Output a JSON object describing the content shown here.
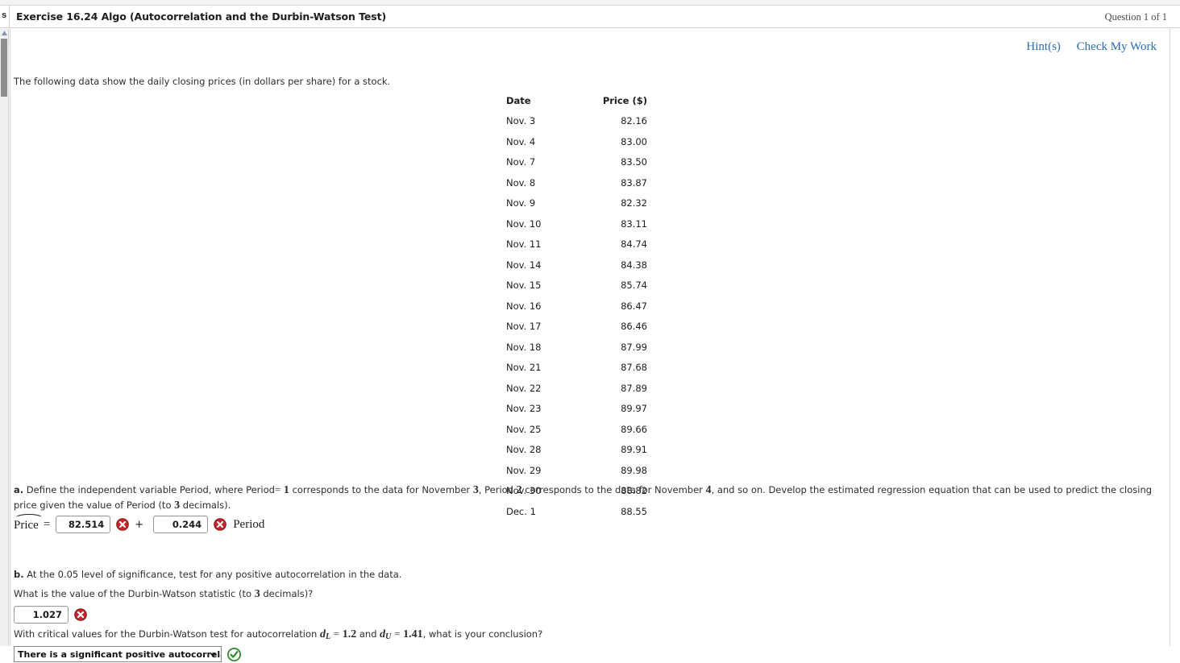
{
  "header": {
    "prev_label": "s",
    "exercise_title": "Exercise 16.24 Algo (Autocorrelation and the Durbin-Watson Test)",
    "question_counter": "Question 1 of 1"
  },
  "tools": {
    "hints_label": "Hint(s)",
    "check_my_work_label": "Check My Work",
    "link_color": "#2b6cb7"
  },
  "intro": {
    "text": "The following data show the daily closing prices (in dollars per share) for a stock."
  },
  "table": {
    "headers": {
      "date": "Date",
      "price": "Price ($)"
    },
    "rows": [
      {
        "date": "Nov. 3",
        "price": "82.16"
      },
      {
        "date": "Nov. 4",
        "price": "83.00"
      },
      {
        "date": "Nov. 7",
        "price": "83.50"
      },
      {
        "date": "Nov. 8",
        "price": "83.87"
      },
      {
        "date": "Nov. 9",
        "price": "82.32"
      },
      {
        "date": "Nov. 10",
        "price": "83.11"
      },
      {
        "date": "Nov. 11",
        "price": "84.74"
      },
      {
        "date": "Nov. 14",
        "price": "84.38"
      },
      {
        "date": "Nov. 15",
        "price": "85.74"
      },
      {
        "date": "Nov. 16",
        "price": "86.47"
      },
      {
        "date": "Nov. 17",
        "price": "86.46"
      },
      {
        "date": "Nov. 18",
        "price": "87.99"
      },
      {
        "date": "Nov. 21",
        "price": "87.68"
      },
      {
        "date": "Nov. 22",
        "price": "87.89"
      },
      {
        "date": "Nov. 23",
        "price": "89.97"
      },
      {
        "date": "Nov. 25",
        "price": "89.66"
      },
      {
        "date": "Nov. 28",
        "price": "89.91"
      },
      {
        "date": "Nov. 29",
        "price": "89.98"
      },
      {
        "date": "Nov. 30",
        "price": "88.82"
      },
      {
        "date": "Dec. 1",
        "price": "88.55"
      }
    ]
  },
  "part_a": {
    "label": "a.",
    "text_1": "Define the independent variable Period, where Period",
    "eq_sign": "=",
    "num_1": "1",
    "text_2": "corresponds to the data for November",
    "num_2": "3",
    "text_3": ", Period",
    "num_3": "2",
    "text_4": "corresponds to the data for November",
    "num_4": "4",
    "text_5": ", and so on. Develop the estimated regression equation that can be used to predict the closing price given the value of Period (to",
    "num_5": "3",
    "text_6": "decimals).",
    "equation": {
      "response_var": "Price",
      "equals": "=",
      "intercept_value": "82.514",
      "intercept_status": "incorrect",
      "plus": "+",
      "slope_value": "0.244",
      "slope_status": "incorrect",
      "predictor_label": "Period"
    }
  },
  "part_b": {
    "label": "b.",
    "text": "At the 0.05 level of significance, test for any positive autocorrelation in the data.",
    "dw_question_1": "What is the value of the Durbin-Watson statistic (to",
    "dw_question_num": "3",
    "dw_question_2": "decimals)?",
    "dw_value": "1.027",
    "dw_status": "incorrect",
    "critical_text_1": "With critical values for the Durbin-Watson test for autocorrelation",
    "dl_symbol": "d",
    "dl_subscript": "L",
    "dl_equals": "=",
    "dl_value": "1.2",
    "and_text": "and",
    "du_symbol": "d",
    "du_subscript": "U",
    "du_equals": "=",
    "du_value": "1.41",
    "critical_text_2": ", what is your conclusion?",
    "conclusion_selected": "There is a significant positive autocorrelation.",
    "conclusion_status": "correct"
  },
  "icons": {
    "incorrect_color": "#c1272d",
    "correct_color": "#2e8b2e",
    "incorrect_name": "incorrect-x-icon",
    "correct_name": "correct-check-icon"
  }
}
